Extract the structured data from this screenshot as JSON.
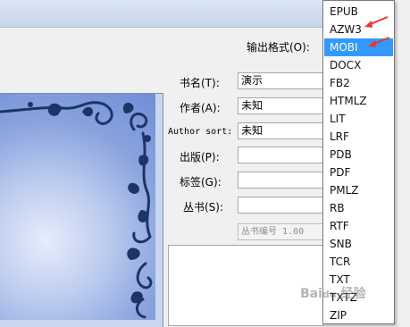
{
  "output_format": {
    "label": "输出格式(O):"
  },
  "metadata": {
    "title_label": "书名(T):",
    "title_value": "演示",
    "author_label": "作者(A):",
    "author_value": "未知",
    "author_sort_label": "Author sort:",
    "author_sort_value": "未知",
    "publisher_label": "出版(P):",
    "publisher_value": "",
    "tags_label": "标签(G):",
    "tags_value": "",
    "series_label": "丛书(S):",
    "series_value": "",
    "series_number": "丛书编号 1.00"
  },
  "format_options": [
    "EPUB",
    "AZW3",
    "MOBI",
    "DOCX",
    "FB2",
    "HTMLZ",
    "LIT",
    "LRF",
    "PDB",
    "PDF",
    "PMLZ",
    "RB",
    "RTF",
    "SNB",
    "TCR",
    "TXT",
    "TXTZ",
    "ZIP"
  ],
  "selected_format": "MOBI",
  "annotation_color": "#e8372c",
  "selection_color": "#3399ff"
}
